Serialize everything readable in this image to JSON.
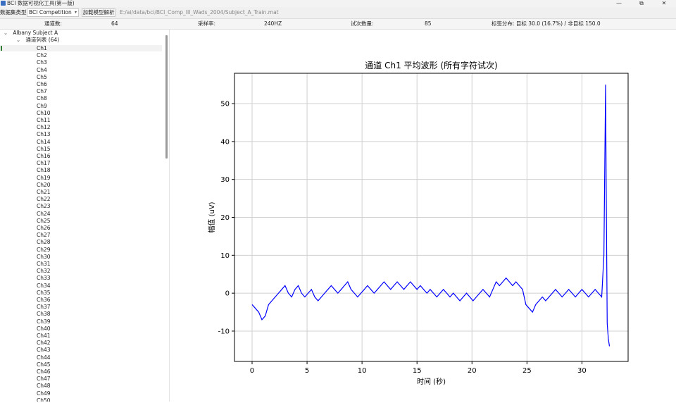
{
  "window": {
    "title": "BCI 数据可视化工具(第一版)",
    "minimize": "—",
    "maximize": "⧉",
    "close": "✕"
  },
  "toolbar": {
    "dataset_label": "数据集类型:",
    "dataset_value": "BCI Competition",
    "load_button": "加载模型解析",
    "file_path": "E:/ai/data/bci/BCI_Comp_III_Wads_2004/Subject_A_Train.mat"
  },
  "info": {
    "channels_label": "通道数:",
    "channels_value": "64",
    "rate_label": "采样率:",
    "rate_value": "240HZ",
    "trials_label": "试次数量:",
    "trials_value": "85",
    "label_dist": "标签分布: 目标 30.0 (16.7%) / 非目标 150.0"
  },
  "tree": {
    "root_label": "Albany Subject A",
    "channel_list_label": "通道列表 (64)",
    "channels": [
      "Ch1",
      "Ch2",
      "Ch3",
      "Ch4",
      "Ch5",
      "Ch6",
      "Ch7",
      "Ch8",
      "Ch9",
      "Ch10",
      "Ch11",
      "Ch12",
      "Ch13",
      "Ch14",
      "Ch15",
      "Ch16",
      "Ch17",
      "Ch18",
      "Ch19",
      "Ch20",
      "Ch21",
      "Ch22",
      "Ch23",
      "Ch24",
      "Ch25",
      "Ch26",
      "Ch27",
      "Ch28",
      "Ch29",
      "Ch30",
      "Ch31",
      "Ch32",
      "Ch33",
      "Ch34",
      "Ch35",
      "Ch36",
      "Ch37",
      "Ch38",
      "Ch39",
      "Ch40",
      "Ch41",
      "Ch42",
      "Ch43",
      "Ch44",
      "Ch45",
      "Ch46",
      "Ch47",
      "Ch48",
      "Ch49",
      "Ch50"
    ],
    "selected_index": 0
  },
  "chart_data": {
    "type": "line",
    "title": "通道 Ch1 平均波形 (所有字符试次)",
    "xlabel": "时间 (秒)",
    "ylabel": "幅值 (uV)",
    "xlim": [
      -1.6,
      34.2
    ],
    "ylim": [
      -18,
      58
    ],
    "xticks": [
      0,
      5,
      10,
      15,
      20,
      25,
      30
    ],
    "yticks": [
      -10,
      0,
      10,
      20,
      30,
      40,
      50
    ],
    "grid": true,
    "series": [
      {
        "color": "#0000ff",
        "x": [
          0,
          0.3,
          0.6,
          0.9,
          1.2,
          1.5,
          1.8,
          2.1,
          2.4,
          2.7,
          3.0,
          3.3,
          3.6,
          3.9,
          4.2,
          4.5,
          4.8,
          5.1,
          5.4,
          5.7,
          6.0,
          6.3,
          6.6,
          6.9,
          7.2,
          7.5,
          7.8,
          8.1,
          8.4,
          8.7,
          9.0,
          9.3,
          9.6,
          9.9,
          10.2,
          10.5,
          10.8,
          11.1,
          11.4,
          11.7,
          12.0,
          12.3,
          12.6,
          12.9,
          13.2,
          13.5,
          13.8,
          14.1,
          14.4,
          14.7,
          15.0,
          15.3,
          15.6,
          15.9,
          16.2,
          16.5,
          16.8,
          17.1,
          17.4,
          17.7,
          18.0,
          18.3,
          18.6,
          18.9,
          19.2,
          19.5,
          19.8,
          20.1,
          20.4,
          20.7,
          21.0,
          21.3,
          21.6,
          21.9,
          22.2,
          22.5,
          22.8,
          23.1,
          23.4,
          23.7,
          24.0,
          24.3,
          24.6,
          24.9,
          25.2,
          25.5,
          25.8,
          26.1,
          26.4,
          26.7,
          27.0,
          27.3,
          27.6,
          27.9,
          28.2,
          28.5,
          28.8,
          29.1,
          29.4,
          29.7,
          30.0,
          30.3,
          30.6,
          30.9,
          31.2,
          31.5,
          31.8,
          32.0,
          32.1,
          32.15,
          32.2,
          32.3,
          32.4,
          32.5
        ],
        "y": [
          -3,
          -4,
          -5,
          -7,
          -6,
          -3,
          -2,
          -1,
          0,
          1,
          2,
          0,
          -1,
          1,
          2,
          0,
          -1,
          0,
          1,
          -1,
          -2,
          -1,
          0,
          1,
          2,
          1,
          0,
          1,
          2,
          3,
          1,
          0,
          -1,
          0,
          1,
          2,
          1,
          0,
          1,
          2,
          3,
          2,
          1,
          2,
          3,
          2,
          1,
          2,
          3,
          2,
          1,
          2,
          1,
          0,
          1,
          0,
          -1,
          0,
          1,
          0,
          -1,
          0,
          -1,
          -2,
          -1,
          0,
          -1,
          -2,
          -1,
          0,
          1,
          0,
          -1,
          1,
          3,
          2,
          3,
          4,
          3,
          2,
          3,
          2,
          1,
          -3,
          -4,
          -5,
          -3,
          -2,
          -1,
          -2,
          -1,
          0,
          1,
          0,
          -1,
          0,
          1,
          0,
          -1,
          0,
          1,
          0,
          -1,
          0,
          1,
          0,
          -1,
          10,
          40,
          55,
          30,
          -8,
          -12,
          -14
        ]
      }
    ]
  }
}
